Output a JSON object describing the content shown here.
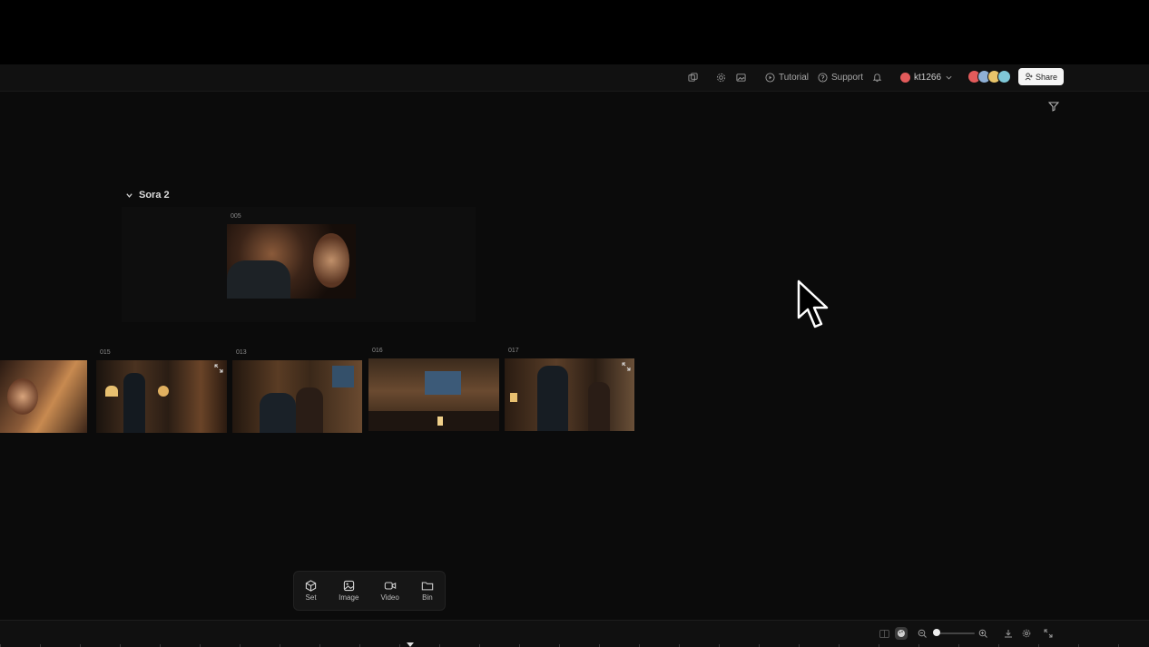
{
  "topbar": {
    "tutorial_label": "Tutorial",
    "support_label": "Support",
    "username": "kt1266",
    "share_label": "Share",
    "icons": [
      "copy-icon",
      "settings-icon",
      "image-icon",
      "play-circle-icon",
      "help-circle-icon",
      "bell-icon",
      "chevron-down-icon",
      "user-plus-icon"
    ],
    "avatar_colors": [
      "#e35b5b",
      "#8fb0d6",
      "#e9c46a",
      "#7fc8d8"
    ]
  },
  "group": {
    "title": "Sora 2",
    "clip": {
      "label": "005"
    }
  },
  "clips": [
    {
      "label": ""
    },
    {
      "label": "015"
    },
    {
      "label": "013"
    },
    {
      "label": "016"
    },
    {
      "label": "017"
    }
  ],
  "toolbar": {
    "items": [
      {
        "label": "Set",
        "icon": "cube-icon"
      },
      {
        "label": "Image",
        "icon": "image-icon"
      },
      {
        "label": "Video",
        "icon": "video-camera-icon"
      },
      {
        "label": "Bin",
        "icon": "folder-icon"
      }
    ]
  },
  "timeline": {
    "zoom_level": 0.1,
    "icons": [
      "layout-icon",
      "palette-icon",
      "zoom-out-icon",
      "zoom-in-icon",
      "download-icon",
      "settings-icon",
      "expand-icon"
    ]
  },
  "colors": {
    "background": "#0b0b0b",
    "accent": "#e35b5b",
    "share_bg": "#f4f4f4"
  }
}
